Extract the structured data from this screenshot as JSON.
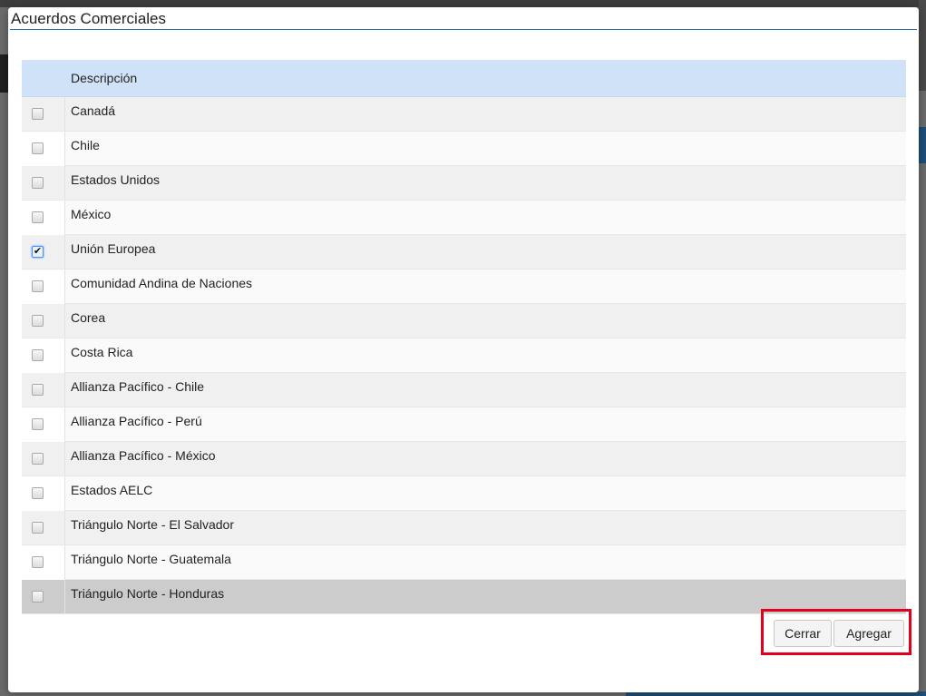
{
  "modal": {
    "title": "Acuerdos Comerciales"
  },
  "grid": {
    "header": {
      "description": "Descripción"
    },
    "rows": [
      {
        "label": "Canadá",
        "checked": false
      },
      {
        "label": "Chile",
        "checked": false
      },
      {
        "label": "Estados Unidos",
        "checked": false
      },
      {
        "label": "México",
        "checked": false
      },
      {
        "label": "Unión Europea",
        "checked": true
      },
      {
        "label": "Comunidad Andina de Naciones",
        "checked": false
      },
      {
        "label": "Corea",
        "checked": false
      },
      {
        "label": "Costa Rica",
        "checked": false
      },
      {
        "label": "Allianza Pacífico - Chile",
        "checked": false
      },
      {
        "label": "Allianza Pacífico - Perú",
        "checked": false
      },
      {
        "label": "Allianza Pacífico - México",
        "checked": false
      },
      {
        "label": "Estados AELC",
        "checked": false
      },
      {
        "label": "Triángulo Norte - El Salvador",
        "checked": false
      },
      {
        "label": "Triángulo Norte - Guatemala",
        "checked": false
      },
      {
        "label": "Triángulo Norte - Honduras",
        "checked": false
      }
    ]
  },
  "buttons": {
    "close_label": "Cerrar",
    "add_label": "Agregar"
  },
  "colors": {
    "highlight_border": "#e2001a",
    "header_bg": "#cfe2f7",
    "title_rule": "#2e6da4"
  }
}
